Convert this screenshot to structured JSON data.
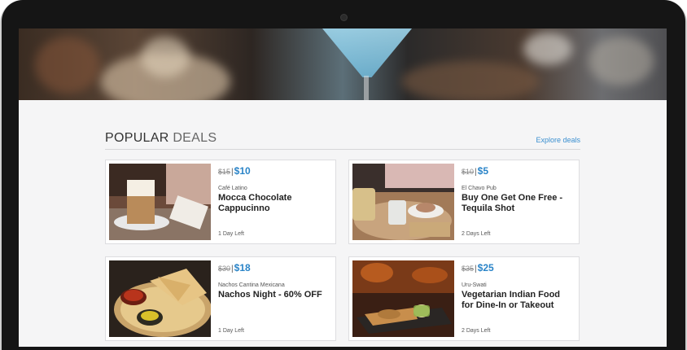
{
  "section": {
    "title_strong": "POPULAR",
    "title_light": "DEALS",
    "explore_label": "Explore deals"
  },
  "deals": [
    {
      "old_price": "$15",
      "separator": "|",
      "new_price": "$10",
      "vendor": "Café Latino",
      "title": "Mocca Chocolate Cappucinno",
      "days_left": "1 Day Left"
    },
    {
      "old_price": "$10",
      "separator": "|",
      "new_price": "$5",
      "vendor": "El Chavo Pub",
      "title": "Buy One Get One Free - Tequila Shot",
      "days_left": "2 Days Left"
    },
    {
      "old_price": "$30",
      "separator": "|",
      "new_price": "$18",
      "vendor": "Nachos Cantina Mexicana",
      "title": "Nachos Night - 60% OFF",
      "days_left": "1 Day Left"
    },
    {
      "old_price": "$35",
      "separator": "|",
      "new_price": "$25",
      "vendor": "Uru-Swati",
      "title": "Vegetarian Indian Food for Dine-In or Takeout",
      "days_left": "2 Days Left"
    }
  ],
  "colors": {
    "accent": "#2a84c8",
    "bezel": "#151515",
    "page_bg": "#f5f5f6"
  }
}
